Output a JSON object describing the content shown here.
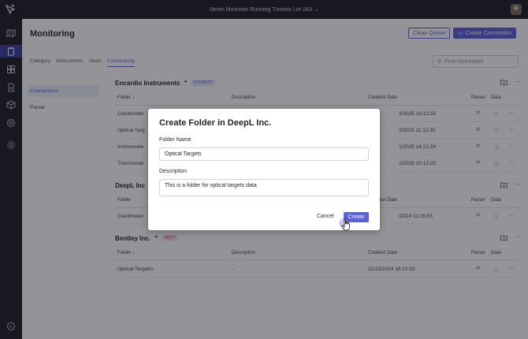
{
  "topbar": {
    "project_name": "Neom Mountain Running Tunnels Lot 2&3"
  },
  "page": {
    "title": "Monitoring",
    "clean_queue_label": "Clean Queue",
    "create_connection_label": "Create Connection"
  },
  "tabs": [
    {
      "label": "Category",
      "active": false
    },
    {
      "label": "Instruments",
      "active": false
    },
    {
      "label": "Alerts",
      "active": false
    },
    {
      "label": "Connectivity",
      "active": true
    }
  ],
  "search": {
    "placeholder": "Find connection"
  },
  "subnav": [
    {
      "label": "Connections",
      "active": true
    },
    {
      "label": "Parser",
      "active": false
    }
  ],
  "columns": {
    "folder": "Folder",
    "description": "Description",
    "creation_date": "Creation Date",
    "parser": "Parser",
    "data": "Data"
  },
  "groups": [
    {
      "name": "Encardio Instruments",
      "protocol": "FTP/SFTP",
      "rows": [
        {
          "folder": "Crackmeter",
          "description": "",
          "date": "3/2025 18:12:33"
        },
        {
          "folder": "Optical Targ",
          "description": "",
          "date": "2/2025 11:12:35"
        },
        {
          "folder": "Inclinomete",
          "description": "",
          "date": "1/2025 14:21:24"
        },
        {
          "folder": "Thermomet",
          "description": "",
          "date": "1/2025 10:12:25"
        }
      ]
    },
    {
      "name": "DeepL Inc",
      "protocol": "",
      "rows": [
        {
          "folder": "Crackmeter",
          "description": "",
          "date": "/2024 11:28:03"
        }
      ]
    },
    {
      "name": "Bentley Inc.",
      "protocol": "MQTT",
      "rows": [
        {
          "folder": "Optical Targetrs",
          "description": "-",
          "date": "21/10/2024 18:12:33"
        }
      ]
    }
  ],
  "modal": {
    "title": "Create Folder in DeepL Inc.",
    "folder_name_label": "Folder Name",
    "folder_name_value": "Optical Targets",
    "description_label": "Description",
    "description_value": "This is a folder for optical targets data",
    "cancel_label": "Cancel",
    "create_label": "Create"
  },
  "colors": {
    "accent": "#5b5fd9",
    "sidebar": "#1d1e27",
    "ftp_chip_bg": "#e4e5fb",
    "mqtt_chip_bg": "#fbe4ea"
  }
}
